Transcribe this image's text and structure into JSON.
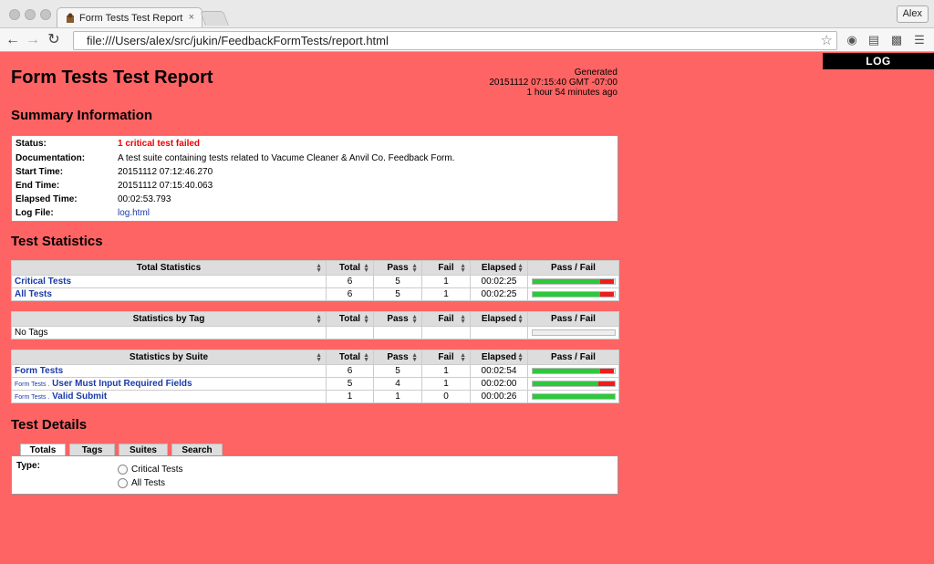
{
  "browser": {
    "tab_title": "Form Tests Test Report",
    "tab_close": "×",
    "url": "file:///Users/alex/src/jukin/FeedbackFormTests/report.html",
    "profile": "Alex"
  },
  "header": {
    "title": "Form Tests Test Report",
    "log_button": "LOG",
    "generated_label": "Generated",
    "generated_time": "20151112 07:15:40 GMT -07:00",
    "generated_ago": "1 hour 54 minutes ago"
  },
  "summary": {
    "heading": "Summary Information",
    "status_label": "Status:",
    "status_value": "1 critical test failed",
    "doc_label": "Documentation:",
    "doc_value": "A test suite containing tests related to Vacume Cleaner & Anvil Co. Feedback Form.",
    "start_label": "Start Time:",
    "start_value": "20151112 07:12:46.270",
    "end_label": "End Time:",
    "end_value": "20151112 07:15:40.063",
    "elapsed_label": "Elapsed Time:",
    "elapsed_value": "00:02:53.793",
    "logfile_label": "Log File:",
    "logfile_value": "log.html"
  },
  "statistics": {
    "heading": "Test Statistics",
    "columns": {
      "total": "Total",
      "pass": "Pass",
      "fail": "Fail",
      "elapsed": "Elapsed",
      "passfail": "Pass / Fail"
    },
    "total": {
      "header": "Total Statistics",
      "rows": [
        {
          "name": "Critical Tests",
          "total": "6",
          "pass": "5",
          "fail": "1",
          "elapsed": "00:02:25",
          "pass_ratio": 0.833
        },
        {
          "name": "All Tests",
          "total": "6",
          "pass": "5",
          "fail": "1",
          "elapsed": "00:02:25",
          "pass_ratio": 0.833
        }
      ]
    },
    "tag": {
      "header": "Statistics by Tag",
      "rows": [
        {
          "name": "No Tags"
        }
      ]
    },
    "suite": {
      "header": "Statistics by Suite",
      "rows": [
        {
          "parent": "",
          "name": "Form Tests",
          "total": "6",
          "pass": "5",
          "fail": "1",
          "elapsed": "00:02:54",
          "pass_ratio": 0.833
        },
        {
          "parent": "Form Tests .",
          "name": "User Must Input Required Fields",
          "total": "5",
          "pass": "4",
          "fail": "1",
          "elapsed": "00:02:00",
          "pass_ratio": 0.8
        },
        {
          "parent": "Form Tests .",
          "name": "Valid Submit",
          "total": "1",
          "pass": "1",
          "fail": "0",
          "elapsed": "00:00:26",
          "pass_ratio": 1.0
        }
      ]
    }
  },
  "details": {
    "heading": "Test Details",
    "tabs": [
      "Totals",
      "Tags",
      "Suites",
      "Search"
    ],
    "active_tab": "Totals",
    "type_label": "Type:",
    "options": [
      "Critical Tests",
      "All Tests"
    ]
  },
  "colors": {
    "page_background": "#ff6464",
    "pass": "#2ec83c",
    "fail": "#ee1c1c",
    "link": "#1a3aa8"
  }
}
